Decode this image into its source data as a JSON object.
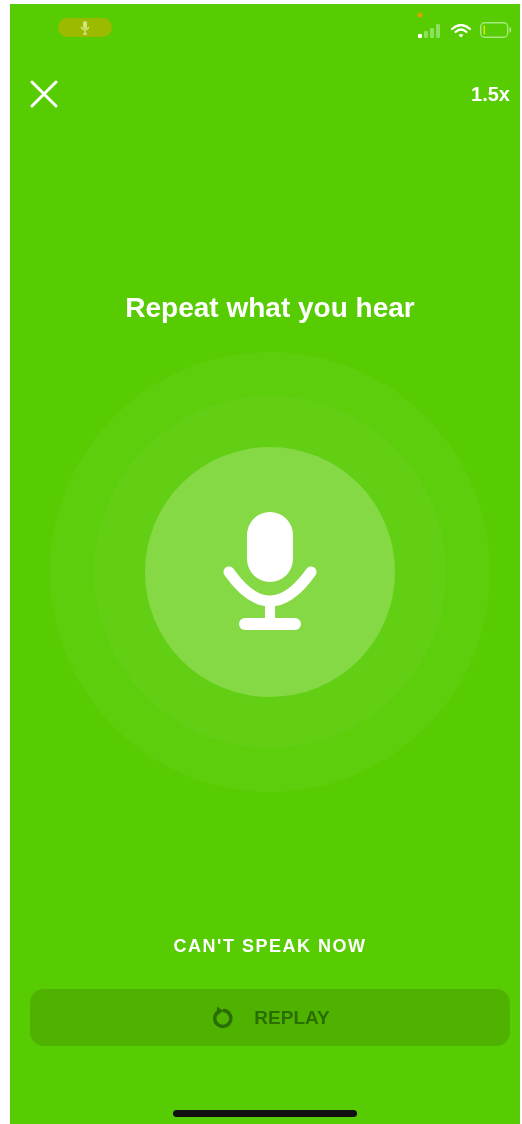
{
  "status_bar": {
    "mic_in_use": true
  },
  "speed": "1.5x",
  "prompt": "Repeat what you hear",
  "skip_button": "CAN'T SPEAK NOW",
  "replay_button": {
    "label": "REPLAY",
    "disabled": true
  }
}
